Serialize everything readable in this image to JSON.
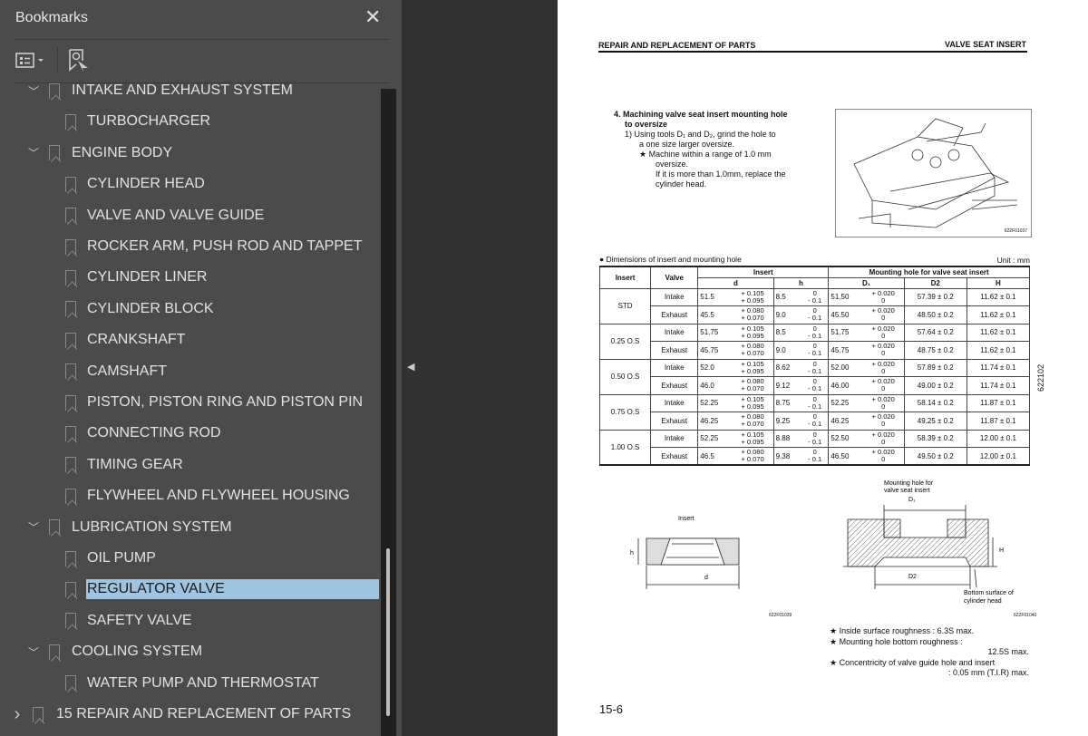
{
  "sidebar": {
    "title": "Bookmarks",
    "close_icon": "close-icon",
    "tools": [
      "bookmark-options-icon",
      "find-current-bookmark-icon"
    ],
    "items": [
      {
        "label": "INTAKE AND EXHAUST SYSTEM",
        "level": 1,
        "expanded": true
      },
      {
        "label": "TURBOCHARGER",
        "level": 2
      },
      {
        "label": "ENGINE BODY",
        "level": 1,
        "expanded": true
      },
      {
        "label": "CYLINDER HEAD",
        "level": 2
      },
      {
        "label": "VALVE AND VALVE GUIDE",
        "level": 2
      },
      {
        "label": "ROCKER ARM, PUSH ROD AND TAPPET",
        "level": 2
      },
      {
        "label": "CYLINDER LINER",
        "level": 2
      },
      {
        "label": "CYLINDER BLOCK",
        "level": 2
      },
      {
        "label": "CRANKSHAFT",
        "level": 2
      },
      {
        "label": "CAMSHAFT",
        "level": 2
      },
      {
        "label": "PISTON, PISTON RING AND PISTON PIN",
        "level": 2
      },
      {
        "label": "CONNECTING ROD",
        "level": 2
      },
      {
        "label": "TIMING GEAR",
        "level": 2
      },
      {
        "label": "FLYWHEEL AND FLYWHEEL HOUSING",
        "level": 2
      },
      {
        "label": "LUBRICATION SYSTEM",
        "level": 1,
        "expanded": true
      },
      {
        "label": "OIL PUMP",
        "level": 2
      },
      {
        "label": "REGULATOR VALVE",
        "level": 2,
        "selected": true
      },
      {
        "label": "SAFETY VALVE",
        "level": 2
      },
      {
        "label": "COOLING SYSTEM",
        "level": 1,
        "expanded": true
      },
      {
        "label": "WATER PUMP AND THERMOSTAT",
        "level": 2
      },
      {
        "label": "15 REPAIR AND REPLACEMENT OF PARTS",
        "level": 0,
        "expanded": false
      }
    ],
    "selected_color": "#9fc4e0"
  },
  "page": {
    "header_left": "REPAIR AND REPLACEMENT OF PARTS",
    "header_right": "VALVE SEAT INSERT",
    "step_title": "4.  Machining valve seat insert mounting hole",
    "step_title2": "to oversize",
    "step1": "1)  Using tools D₁ and D₂, grind the hole to",
    "step1b": "a one size larger oversize.",
    "note1": "★  Machine within a range of 1.0 mm",
    "note1b": "oversize.",
    "note1c": "If it is more than 1.0mm, replace the",
    "note1d": "cylinder head.",
    "fig1_code": "622F01037",
    "table_caption": "●  Dimensions of insert and mounting hole",
    "unit": "Unit : mm",
    "table": {
      "headers": {
        "insert": "Insert",
        "valve": "Valve",
        "insert_group": "Insert",
        "mount_group": "Mounting hole for valve seat insert",
        "d": "d",
        "h": "h",
        "D1": "D₁",
        "D2": "D2",
        "H": "H"
      },
      "groups": [
        {
          "name": "STD",
          "rows": [
            [
              "Intake",
              "51.5",
              "+ 0.105",
              "+ 0.095",
              "8.5",
              "0",
              "- 0.1",
              "51.50",
              "+ 0.020",
              "0",
              "57.39  ± 0.2",
              "11.62 ± 0.1"
            ],
            [
              "Exhaust",
              "45.5",
              "+ 0.080",
              "+ 0.070",
              "9.0",
              "0",
              "- 0.1",
              "45.50",
              "+ 0.020",
              "0",
              "48.50 ± 0.2",
              "11.62 ± 0.1"
            ]
          ]
        },
        {
          "name": "0.25 O.S",
          "rows": [
            [
              "Intake",
              "51.75",
              "+ 0.105",
              "+ 0.095",
              "8.5",
              "0",
              "- 0.1",
              "51.75",
              "+ 0.020",
              "0",
              "57.64  ± 0.2",
              "11.62 ± 0.1"
            ],
            [
              "Exhaust",
              "45.75",
              "+ 0.080",
              "+ 0.070",
              "9.0",
              "0",
              "- 0.1",
              "45.75",
              "+ 0.020",
              "0",
              "48.75 ± 0.2",
              "11.62 ± 0.1"
            ]
          ]
        },
        {
          "name": "0.50 O.S",
          "rows": [
            [
              "Intake",
              "52.0",
              "+ 0.105",
              "+ 0.095",
              "8.62",
              "0",
              "- 0.1",
              "52.00",
              "+ 0.020",
              "0",
              "57.89  ± 0.2",
              "11.74 ± 0.1"
            ],
            [
              "Exhaust",
              "46.0",
              "+ 0.080",
              "+ 0.070",
              "9.12",
              "0",
              "- 0.1",
              "46.00",
              "+ 0.020",
              "0",
              "49.00  ± 0.2",
              "11.74 ± 0.1"
            ]
          ]
        },
        {
          "name": "0.75 O.S",
          "rows": [
            [
              "Intake",
              "52.25",
              "+ 0.105",
              "+ 0.095",
              "8.75",
              "0",
              "- 0.1",
              "52.25",
              "+ 0.020",
              "0",
              "58.14  ± 0.2",
              "11.87 ± 0.1"
            ],
            [
              "Exhaust",
              "46.25",
              "+ 0.080",
              "+ 0.070",
              "9.25",
              "0",
              "- 0.1",
              "46.25",
              "+ 0.020",
              "0",
              "49.25  ± 0.2",
              "11.87 ± 0.1"
            ]
          ]
        },
        {
          "name": "1.00 O.S",
          "rows": [
            [
              "Intake",
              "52.25",
              "+ 0.105",
              "+ 0.095",
              "8.88",
              "0",
              "- 0.1",
              "52.50",
              "+ 0.020",
              "0",
              "58.39  ± 0.2",
              "12.00 ± 0.1"
            ],
            [
              "Exhaust",
              "46.5",
              "+ 0.080",
              "+ 0.070",
              "9.38",
              "0",
              "- 0.1",
              "46.50",
              "+ 0.020",
              "0",
              "49.50  ± 0.2",
              "12.00 ± 0.1"
            ]
          ]
        }
      ]
    },
    "fig2": {
      "label": "Insert",
      "h": "h",
      "d": "d",
      "code": "622F01039"
    },
    "fig3": {
      "label1": "Mounting hole for",
      "label2": "valve seat insert",
      "D1": "D₁",
      "H": "H",
      "D2": "D2",
      "bottom1": "Bottom surface of",
      "bottom2": "cylinder head",
      "code": "622F01040"
    },
    "notes": [
      "★   Inside surface roughness : 6.3S max.",
      "★   Mounting hole bottom roughness :",
      "12.5S max.",
      "★   Concentricity of valve guide hole and insert",
      ": 0.05 mm (T.I.R) max."
    ],
    "side_code": "622102",
    "page_number": "15-6"
  }
}
